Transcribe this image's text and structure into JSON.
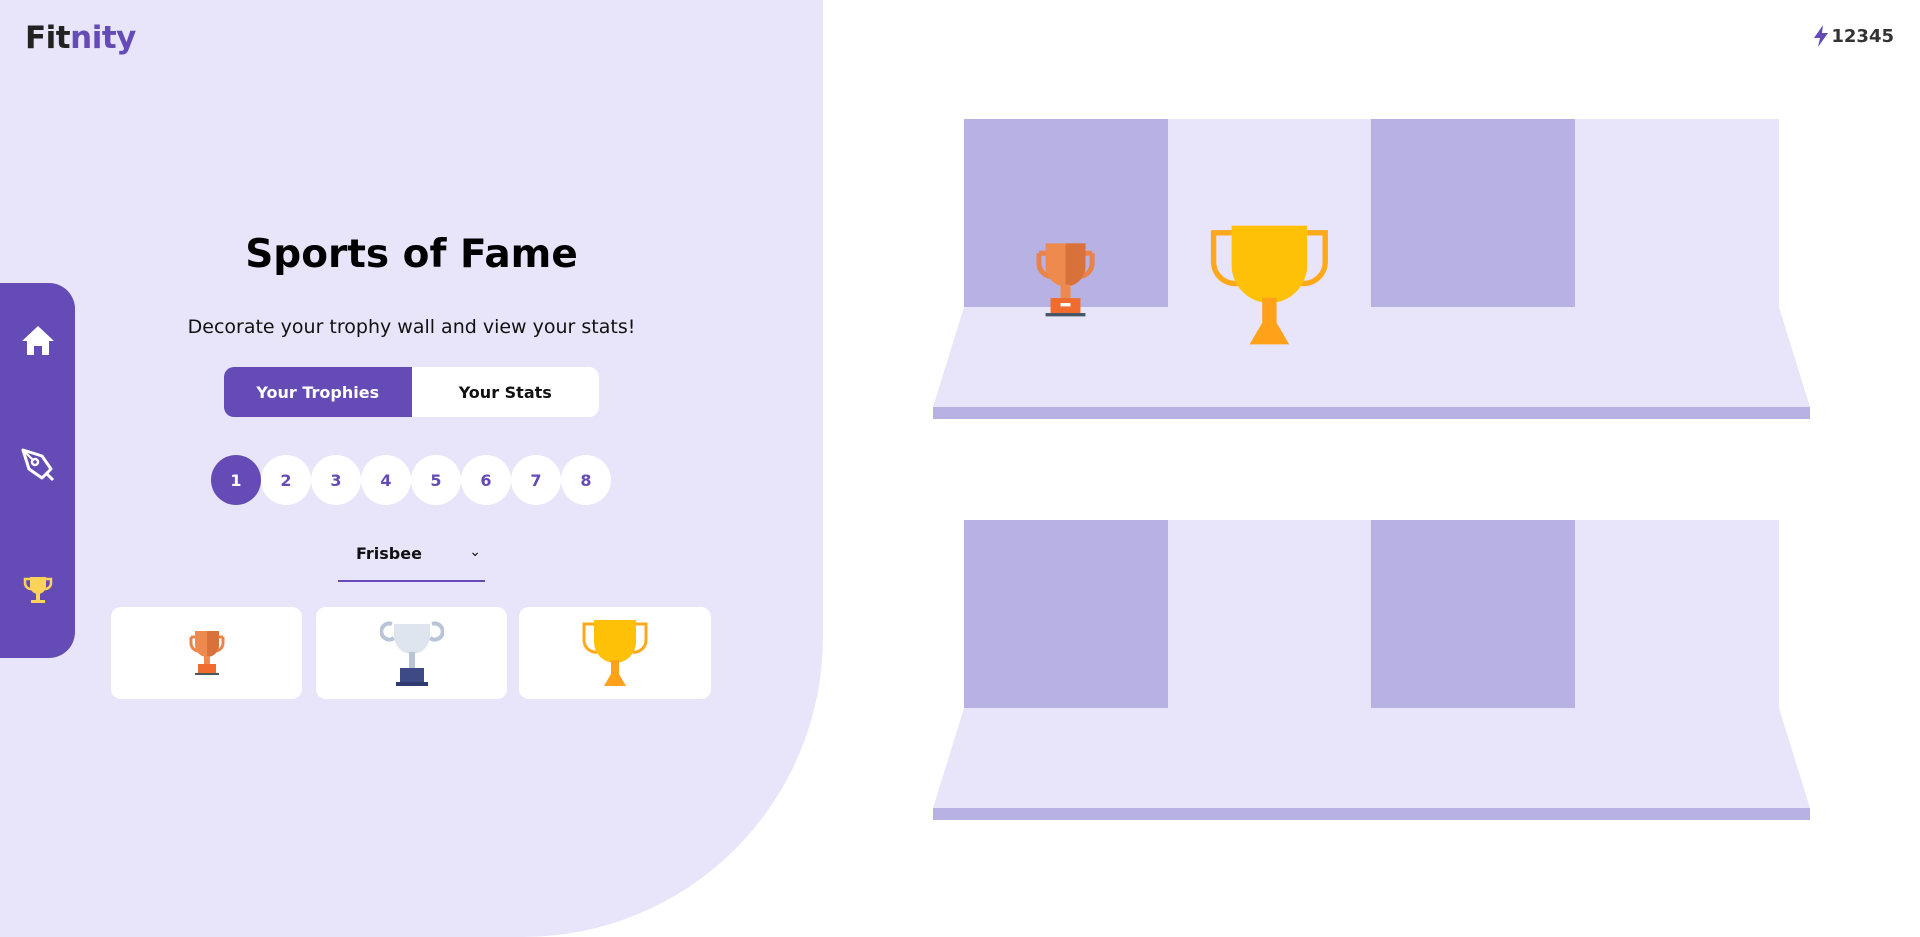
{
  "brand": {
    "part1": "Fit",
    "part2": "nity",
    "accent": "#654bb5"
  },
  "sidebar": {
    "items": [
      {
        "icon": "home-icon"
      },
      {
        "icon": "pen-icon"
      },
      {
        "icon": "trophy-icon",
        "active": true
      }
    ]
  },
  "main": {
    "title": "Sports of Fame",
    "subtitle": "Decorate your trophy wall and view your stats!",
    "tabs": [
      {
        "label": "Your Trophies",
        "active": true
      },
      {
        "label": "Your Stats",
        "active": false
      }
    ],
    "pages": [
      "1",
      "2",
      "3",
      "4",
      "5",
      "6",
      "7",
      "8"
    ],
    "selected_page": "1",
    "sport_select": {
      "value": "Frisbee"
    },
    "trophies": [
      {
        "type": "bronze"
      },
      {
        "type": "silver"
      },
      {
        "type": "gold"
      }
    ]
  },
  "header": {
    "points": "12345",
    "points_icon": "lightning-icon"
  },
  "wall": {
    "shelf1": [
      "bronze",
      "gold"
    ],
    "shelf2": []
  }
}
